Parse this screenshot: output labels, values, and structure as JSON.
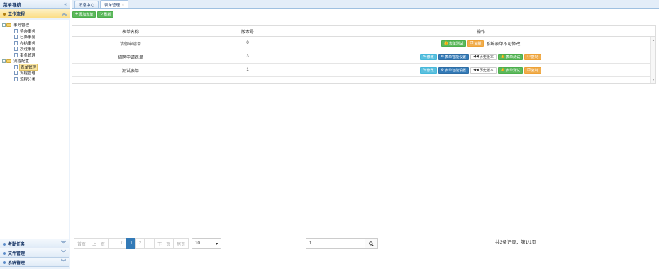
{
  "sidebar": {
    "title": "菜单导航",
    "collapse_icon": "«",
    "active_section": "工作流程",
    "tree": [
      {
        "label": "事务管理",
        "type": "folder",
        "level": 0,
        "toggle": "−"
      },
      {
        "label": "待办事务",
        "type": "file",
        "level": 1
      },
      {
        "label": "已办事务",
        "type": "file",
        "level": 1
      },
      {
        "label": "办结事务",
        "type": "file",
        "level": 1
      },
      {
        "label": "抄送事务",
        "type": "file",
        "level": 1
      },
      {
        "label": "事务管理",
        "type": "file",
        "level": 1
      },
      {
        "label": "流程配置",
        "type": "folder",
        "level": 0,
        "toggle": "−"
      },
      {
        "label": "表单管理",
        "type": "file",
        "level": 1,
        "selected": true
      },
      {
        "label": "流程管理",
        "type": "file",
        "level": 1
      },
      {
        "label": "流程分类",
        "type": "file",
        "level": 1
      }
    ],
    "bottom_sections": [
      "考勤任务",
      "文件管理",
      "系统管理"
    ]
  },
  "tabs": [
    {
      "label": "消息中心",
      "active": false
    },
    {
      "label": "表单管理",
      "active": true,
      "closable": "×"
    }
  ],
  "toolbar": {
    "add_label": "添加表单",
    "refresh_label": "刷新"
  },
  "grid": {
    "headers": {
      "name": "表单名称",
      "version": "版本号",
      "ops": "操作"
    },
    "rows": [
      {
        "name": "请假申请单",
        "version": "0",
        "system": true,
        "note": "系统表单不可修改"
      },
      {
        "name": "招聘申请表单",
        "version": "3",
        "system": false
      },
      {
        "name": "测试表单",
        "version": "1",
        "system": false
      }
    ],
    "op_labels": {
      "edit": "修改",
      "smart": "表单智能设置",
      "history": "历史版本",
      "test": "表单测试",
      "copy": "复制"
    }
  },
  "pager": {
    "first": "首页",
    "prev": "上一页",
    "ellipsis": "...",
    "pages": [
      "0",
      "1",
      "2"
    ],
    "current": "1",
    "next": "下一页",
    "last": "尾页",
    "page_size": "10",
    "jump_value": "1",
    "summary": "共3条记录，第1/1页"
  },
  "colors": {
    "green": "#5cb85c",
    "orange": "#f0ad4e",
    "info": "#5bc0de",
    "primary": "#337ab7"
  }
}
